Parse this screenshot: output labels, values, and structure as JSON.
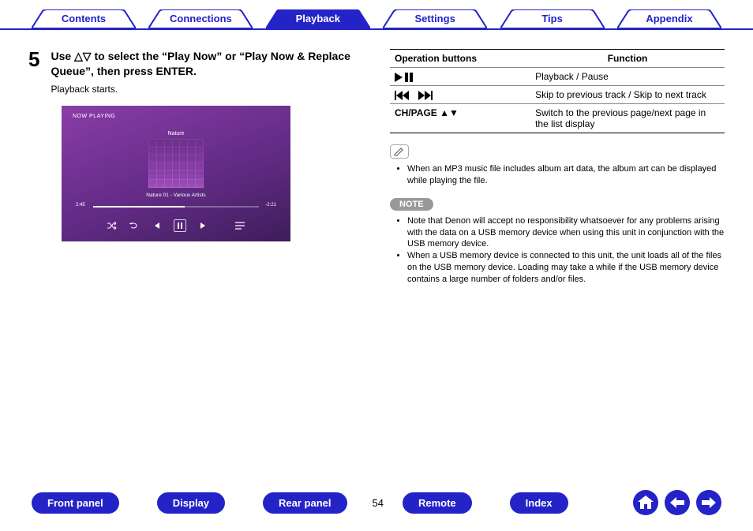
{
  "tabs": {
    "contents": "Contents",
    "connections": "Connections",
    "playback": "Playback",
    "settings": "Settings",
    "tips": "Tips",
    "appendix": "Appendix",
    "active": "playback"
  },
  "step": {
    "number": "5",
    "title": "Use △▽ to select the “Play Now” or “Play Now & Replace Queue”, then press ENTER.",
    "subtitle": "Playback starts."
  },
  "player": {
    "now_playing": "NOW PLAYING",
    "album": "Nature",
    "track": "Nature 01 - Various Artists",
    "elapsed": "2:45",
    "remaining": "-2:21"
  },
  "table": {
    "head_op": "Operation buttons",
    "head_fn": "Function",
    "rows": [
      {
        "fn": "Playback / Pause"
      },
      {
        "fn": "Skip to previous track / Skip to next track"
      },
      {
        "op": "CH/PAGE ▲▼",
        "fn": "Switch to the previous page/next page in the list display"
      }
    ]
  },
  "tip_bullets": [
    "When an MP3 music file includes album art data, the album art can be displayed while playing the file."
  ],
  "note_label": "NOTE",
  "note_bullets": [
    "Note that Denon will accept no responsibility whatsoever for any problems arising with the data on a USB memory device when using this unit in conjunction with the USB memory device.",
    "When a USB memory device is connected to this unit, the unit loads all of the files on the USB memory device. Loading may take a while if the USB memory device contains a large number of folders and/or files."
  ],
  "bottom": {
    "front_panel": "Front panel",
    "display": "Display",
    "rear_panel": "Rear panel",
    "remote": "Remote",
    "index": "Index",
    "page": "54"
  }
}
